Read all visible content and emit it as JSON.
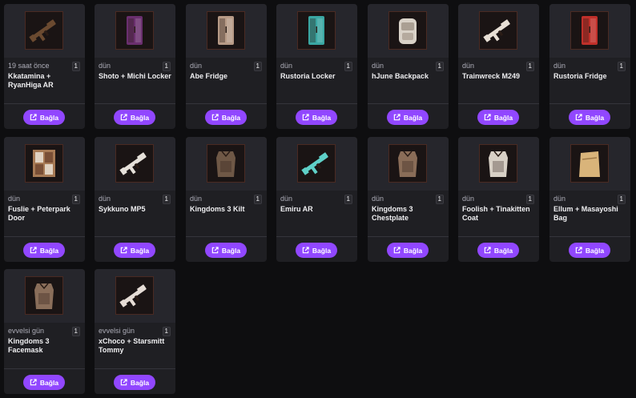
{
  "link_label": "Bağla",
  "items": [
    {
      "time": "19 saat önce",
      "qty": "1",
      "name": "Kkatamina + RyanHiga AR",
      "icon": "rifle-icon",
      "color": "#6b4a30"
    },
    {
      "time": "dün",
      "qty": "1",
      "name": "Shoto + Michi Locker",
      "icon": "locker-icon",
      "color": "#6a2f6e"
    },
    {
      "time": "dün",
      "qty": "1",
      "name": "Abe Fridge",
      "icon": "fridge-icon",
      "color": "#b79a86"
    },
    {
      "time": "dün",
      "qty": "1",
      "name": "Rustoria Locker",
      "icon": "locker-icon",
      "color": "#3aa6a2"
    },
    {
      "time": "dün",
      "qty": "1",
      "name": "hJune Backpack",
      "icon": "backpack-icon",
      "color": "#d9d2c8"
    },
    {
      "time": "dün",
      "qty": "1",
      "name": "Trainwreck M249",
      "icon": "machine-gun-icon",
      "color": "#e8e0d6"
    },
    {
      "time": "dün",
      "qty": "1",
      "name": "Rustoria Fridge",
      "icon": "fridge-icon",
      "color": "#c0302a"
    },
    {
      "time": "dün",
      "qty": "1",
      "name": "Fuslie + Peterpark Door",
      "icon": "door-icon",
      "color": "#a77a55"
    },
    {
      "time": "dün",
      "qty": "1",
      "name": "Sykkuno MP5",
      "icon": "smg-icon",
      "color": "#e6e1da"
    },
    {
      "time": "dün",
      "qty": "1",
      "name": "Kingdoms 3 Kilt",
      "icon": "kilt-icon",
      "color": "#6f5846"
    },
    {
      "time": "dün",
      "qty": "1",
      "name": "Emiru AR",
      "icon": "rifle-icon",
      "color": "#5fd0c8"
    },
    {
      "time": "dün",
      "qty": "1",
      "name": "Kingdoms 3 Chestplate",
      "icon": "chestplate-icon",
      "color": "#8a6d58"
    },
    {
      "time": "dün",
      "qty": "1",
      "name": "Foolish + Tinakitten Coat",
      "icon": "coat-icon",
      "color": "#d8d0c6"
    },
    {
      "time": "dün",
      "qty": "1",
      "name": "Ellum + Masayoshi Bag",
      "icon": "bag-icon",
      "color": "#d9b47a"
    },
    {
      "time": "evvelsi gün",
      "qty": "1",
      "name": "Kingdoms 3 Facemask",
      "icon": "facemask-icon",
      "color": "#8a6e5a"
    },
    {
      "time": "evvelsi gün",
      "qty": "1",
      "name": "xChoco + Starsmitt Tommy",
      "icon": "tommy-gun-icon",
      "color": "#e6ddd6"
    }
  ]
}
